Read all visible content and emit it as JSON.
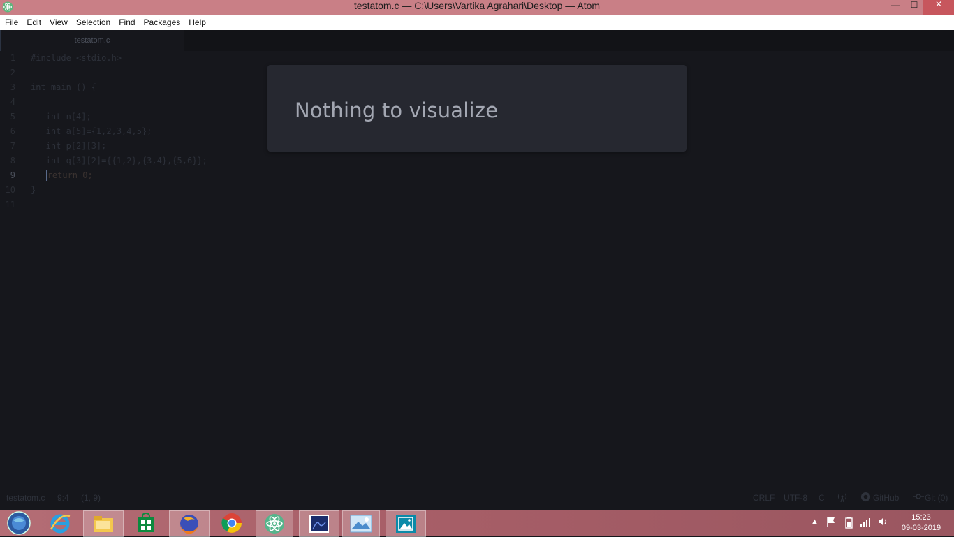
{
  "window": {
    "title": "testatom.c — C:\\Users\\Vartika Agrahari\\Desktop — Atom",
    "minimize_glyph": "—",
    "maximize_glyph": "☐",
    "close_glyph": "✕"
  },
  "menu": [
    "File",
    "Edit",
    "View",
    "Selection",
    "Find",
    "Packages",
    "Help"
  ],
  "tab": {
    "label": "testatom.c"
  },
  "editor": {
    "line_numbers": [
      "1",
      "2",
      "3",
      "4",
      "5",
      "6",
      "7",
      "8",
      "9",
      "10",
      "11"
    ],
    "lines": [
      "#include <stdio.h>",
      "",
      "int main () {",
      "",
      "   int n[4];",
      "   int a[5]={1,2,3,4,5};",
      "   int p[2][3];",
      "   int q[3][2]={{1,2},{3,4},{5,6}};",
      "   return 0;",
      "}",
      ""
    ],
    "active_line": 9
  },
  "notification": {
    "message": "Nothing to visualize"
  },
  "status": {
    "file": "testatom.c",
    "cursor": "9:4",
    "selection": "(1, 9)",
    "line_ending": "CRLF",
    "encoding": "UTF-8",
    "grammar": "C",
    "github": "GitHub",
    "git": "Git (0)"
  },
  "taskbar": {
    "time": "15:23",
    "date": "09-03-2019",
    "apps": [
      "start",
      "internet-explorer",
      "file-explorer",
      "store",
      "firefox",
      "chrome",
      "atom",
      "photos-app",
      "image-viewer",
      "photos"
    ]
  },
  "colors": {
    "titlebar": "#c97f86",
    "editor_bg": "#16171c",
    "notification_bg": "#262830"
  }
}
